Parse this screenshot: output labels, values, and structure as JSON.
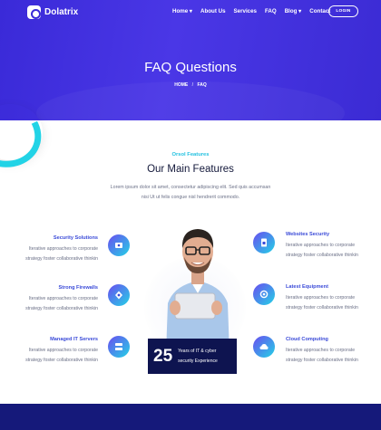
{
  "header": {
    "brand": "Dolatrix",
    "nav": [
      "Home ▾",
      "About Us",
      "Services",
      "FAQ",
      "Blog ▾",
      "Contact"
    ],
    "login_label": "LOGIN",
    "title": "FAQ Questions",
    "breadcrumb": [
      "HOME",
      "/",
      "FAQ"
    ]
  },
  "features_section": {
    "eyebrow": "Orsol Features",
    "title": "Our Main Features",
    "description": "Lorem ipsum dolor sit amet, consectetur adipiscing elit. Sed quis accumsan nisi Ut ut felis congue nisl hendrerit commodo."
  },
  "features_left": [
    {
      "title": "Security Solutions",
      "desc": "Iterative approaches to corporate strategy foster collaborative thinkin",
      "icon": "shield-lock-icon",
      "color": "#3a4ad8"
    },
    {
      "title": "Strong Firewalls",
      "desc": "Iterative approaches to corporate strategy foster collaborative thinkin",
      "icon": "firewall-icon",
      "color": "#3a4ad8"
    },
    {
      "title": "Managed IT Servers",
      "desc": "Iterative approaches to corporate strategy foster collaborative thinkin",
      "icon": "server-icon",
      "color": "#3a4ad8"
    }
  ],
  "features_right": [
    {
      "title": "Websites Security",
      "desc": "Iterative approaches to corporate strategy foster collaborative thinkin",
      "icon": "document-lock-icon",
      "color": "#3a4ad8"
    },
    {
      "title": "Latest Equipment",
      "desc": "Iterative approaches to corporate strategy foster collaborative thinkin",
      "icon": "gear-shield-icon",
      "color": "#3a4ad8"
    },
    {
      "title": "Cloud Computing",
      "desc": "Iterative approaches to corporate strategy foster collaborative thinkin",
      "icon": "cloud-icon",
      "color": "#3a4ad8"
    }
  ],
  "experience": {
    "number": "25",
    "line1": "Years of IT & cyber",
    "line2": "security Experience"
  },
  "colors": {
    "hero_gradient_start": "#3a2ad8",
    "accent_cyan": "#22c1e0",
    "feature_title": "#3a4ad8",
    "dark_navy": "#0e1450",
    "icon_gradient_start": "#6a4cf0",
    "icon_gradient_end": "#22d3e6"
  }
}
